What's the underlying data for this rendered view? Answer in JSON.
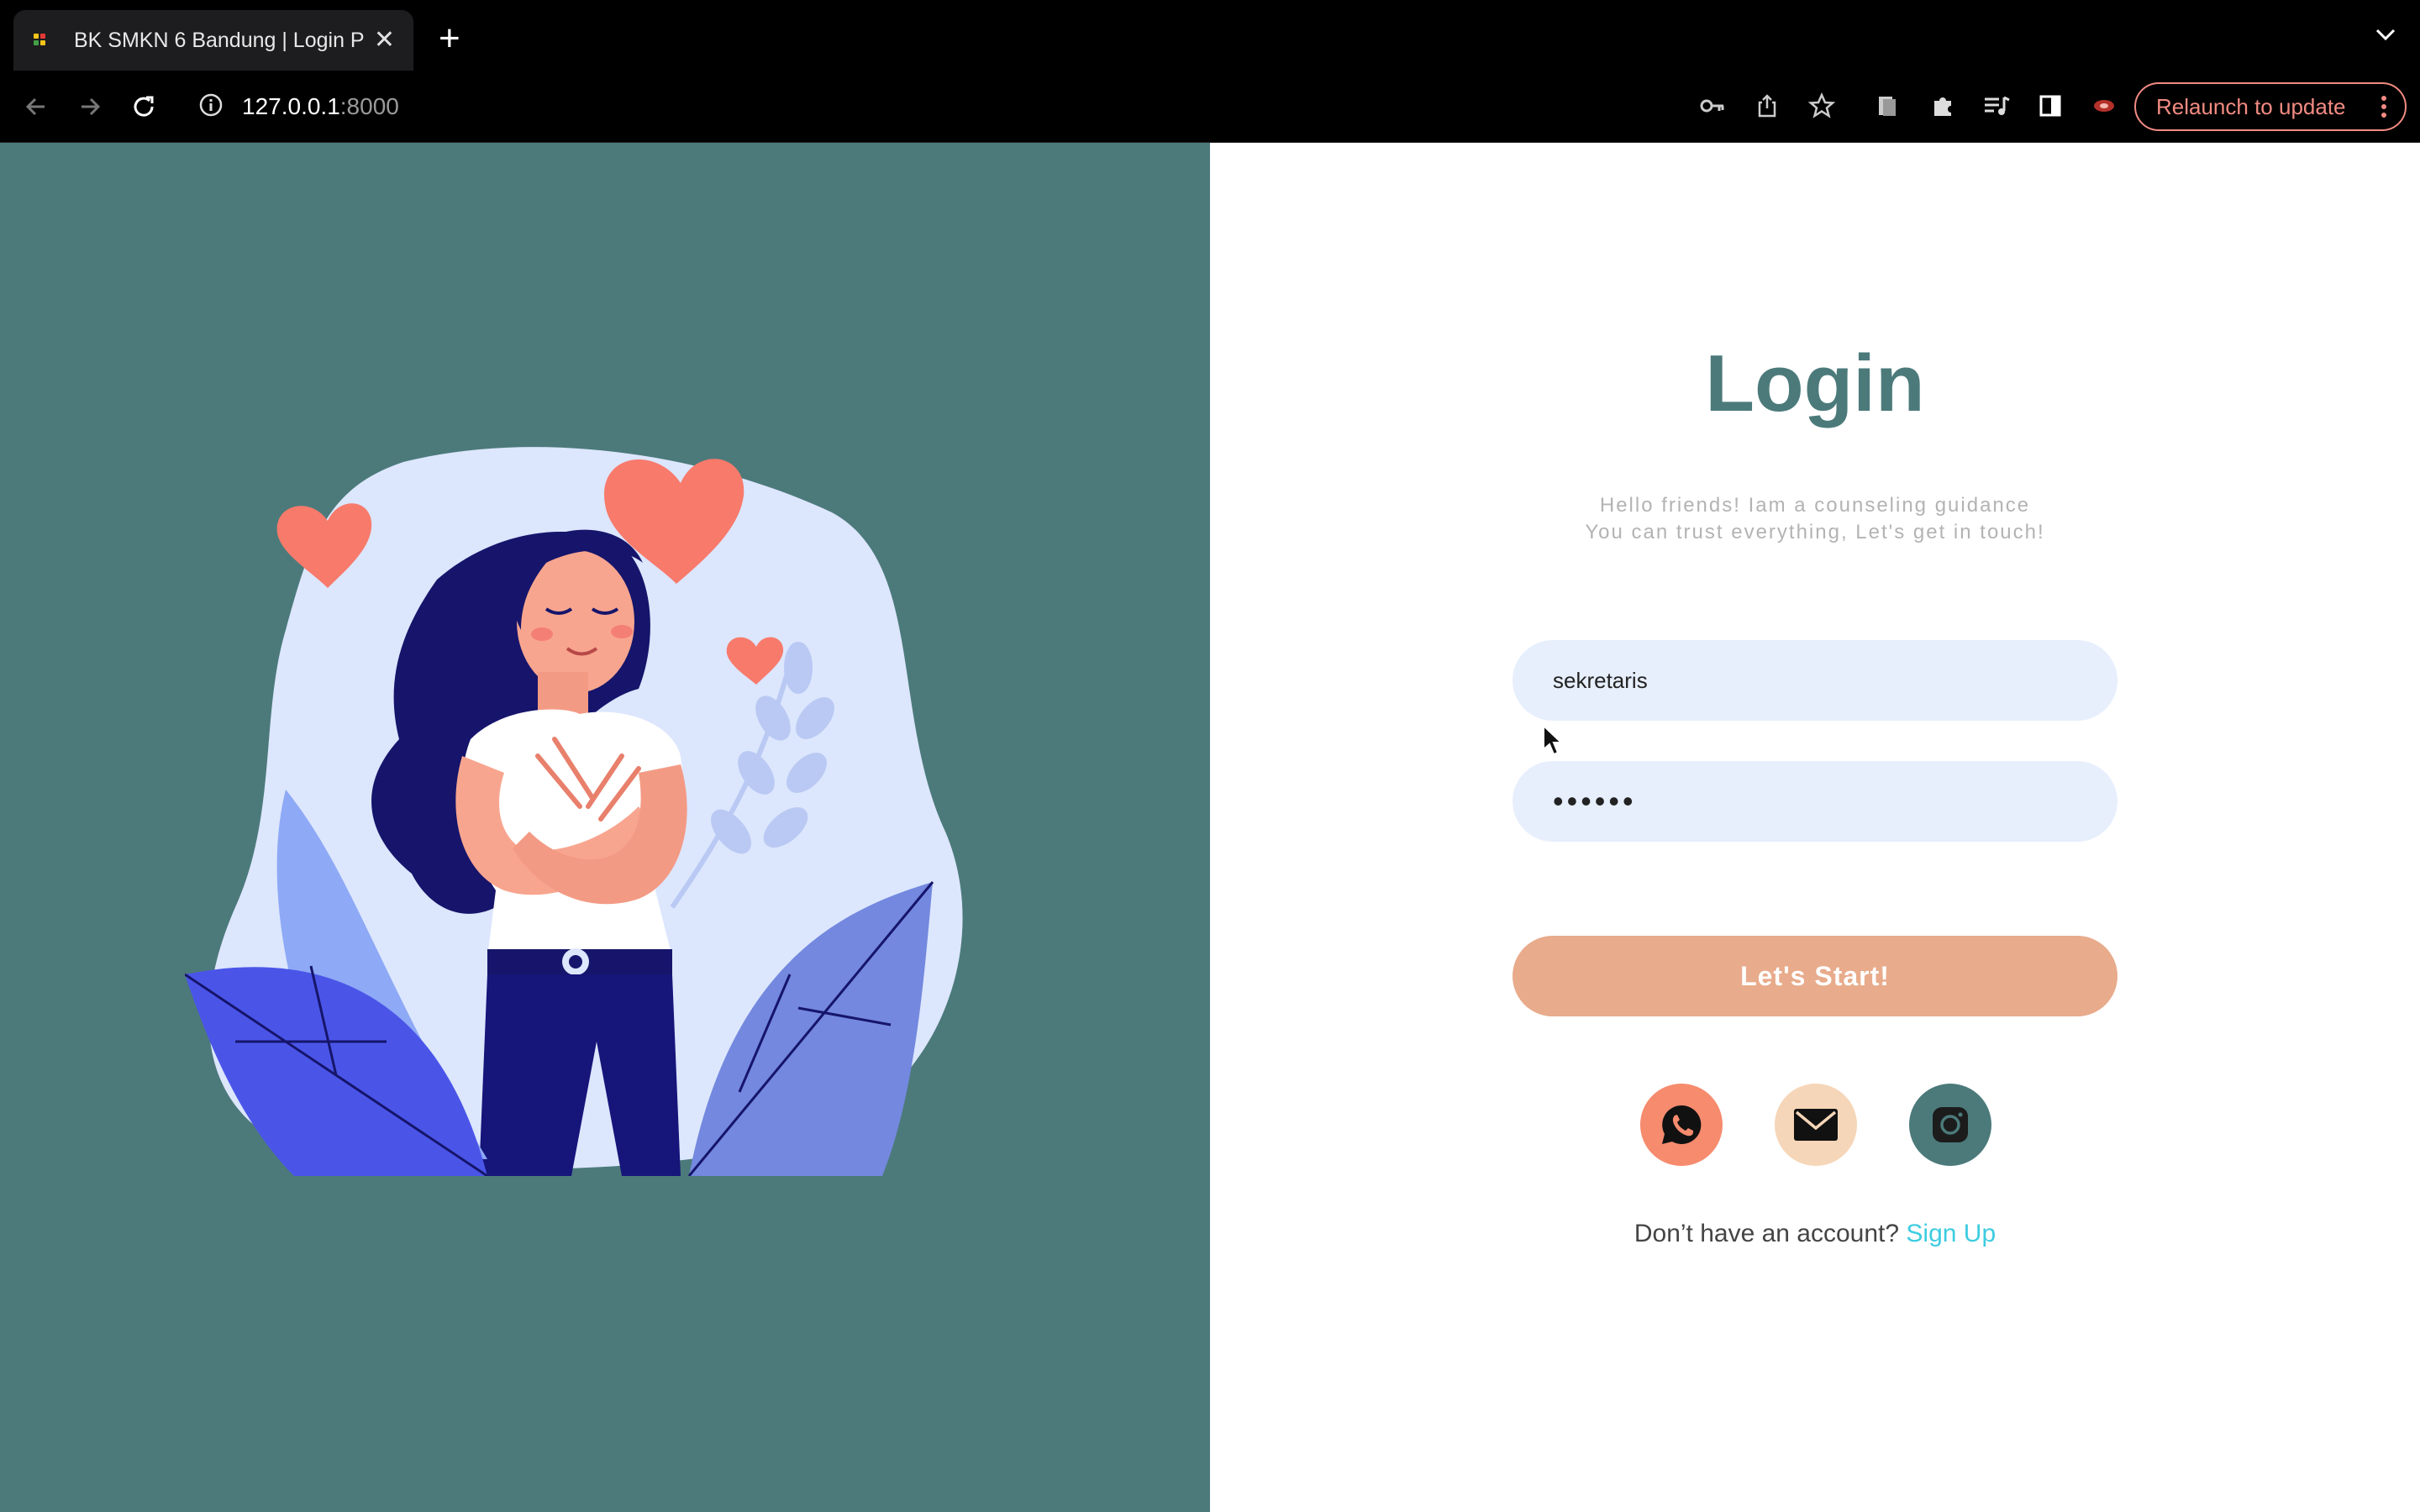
{
  "browser": {
    "tab_title": "BK SMKN 6 Bandung | Login P",
    "url_host": "127.0.0.1",
    "url_port": ":8000",
    "relaunch_label": "Relaunch to update",
    "toolbar_icons": [
      "back-icon",
      "forward-icon",
      "reload-icon",
      "info-icon",
      "key-icon",
      "share-icon",
      "star-icon",
      "reading-list-icon",
      "extensions-icon",
      "media-icon",
      "sidepanel-icon",
      "profile-icon",
      "more-icon"
    ]
  },
  "login": {
    "title": "Login",
    "subtitle_line1": "Hello friends! Iam a counseling guidance",
    "subtitle_line2": "You can trust everything, Let's get in touch!",
    "username_value": "sekretaris",
    "password_value": "••••••",
    "submit_label": "Let's Start!",
    "social": [
      {
        "name": "whatsapp-icon",
        "color": "#f68b6e"
      },
      {
        "name": "mail-icon",
        "color": "#f6d6b8"
      },
      {
        "name": "instagram-icon",
        "color": "#4c7a7b"
      }
    ],
    "signup_prompt": "Don’t have an account?",
    "signup_link": "Sign Up"
  },
  "colors": {
    "brand_teal": "#4c7a7b",
    "button_peach": "#e8ab8b",
    "input_bg": "#e7effd",
    "link_cyan": "#3dcce0"
  }
}
